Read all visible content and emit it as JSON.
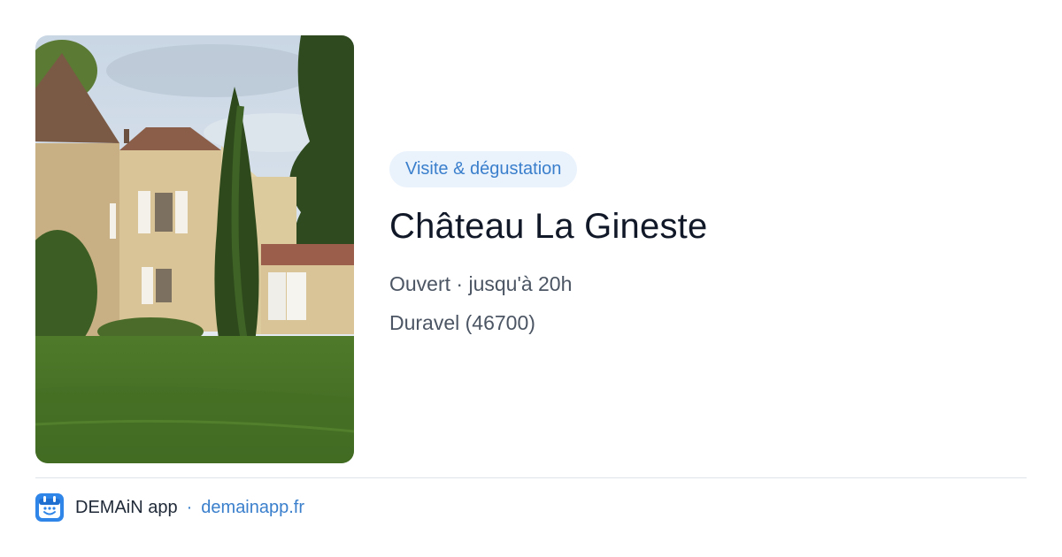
{
  "place": {
    "category": "Visite & dégustation",
    "name": "Château La Gineste",
    "status": "Ouvert · jusqu'à 20h",
    "location": "Duravel (46700)"
  },
  "footer": {
    "app_name": "DEMAiN app",
    "separator": "·",
    "url": "demainapp.fr"
  },
  "colors": {
    "accent": "#3a7fcc",
    "badge_background": "#eaf2fc",
    "title": "#111827",
    "meta_text": "#4b5563"
  },
  "icons": {
    "app_logo": "demain-app-logo-icon"
  }
}
